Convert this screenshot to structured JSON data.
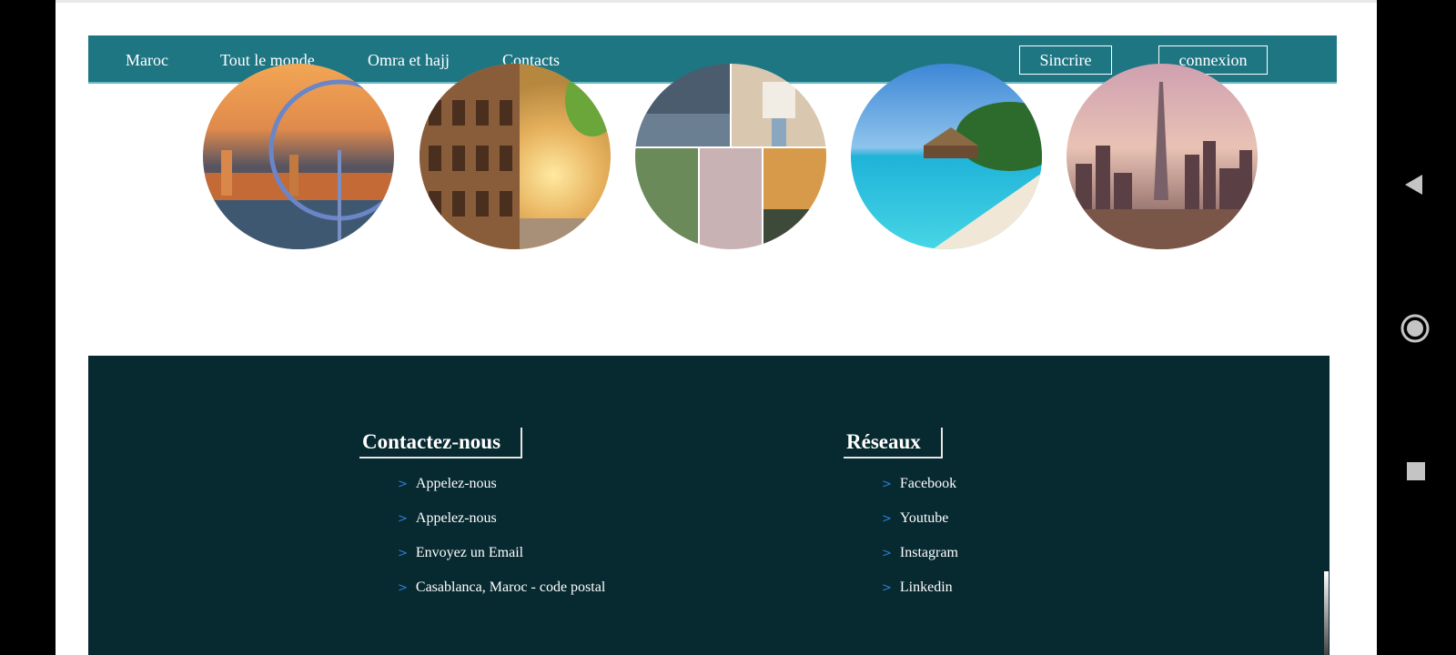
{
  "nav": {
    "links": [
      "Maroc",
      "Tout le monde",
      "Omra et hajj",
      "Contacts"
    ],
    "signup_label": "Sincrire",
    "login_label": "connexion"
  },
  "destinations": [
    {
      "icon": "london-image"
    },
    {
      "icon": "rome-colosseum-image"
    },
    {
      "icon": "asia-collage-image"
    },
    {
      "icon": "maldives-beach-image"
    },
    {
      "icon": "dubai-skyline-image"
    }
  ],
  "footer": {
    "contact": {
      "title": "Contactez-nous",
      "items": [
        "Appelez-nous",
        "Appelez-nous",
        "Envoyez un Email",
        "Casablanca, Maroc - code postal"
      ]
    },
    "social": {
      "title": "Réseaux",
      "items": [
        "Facebook",
        "Youtube",
        "Instagram",
        "Linkedin"
      ]
    },
    "chevron": ">"
  },
  "colors": {
    "nav_bg": "#1f7683",
    "footer_bg": "#072930",
    "chevron": "#2c7fd7"
  }
}
